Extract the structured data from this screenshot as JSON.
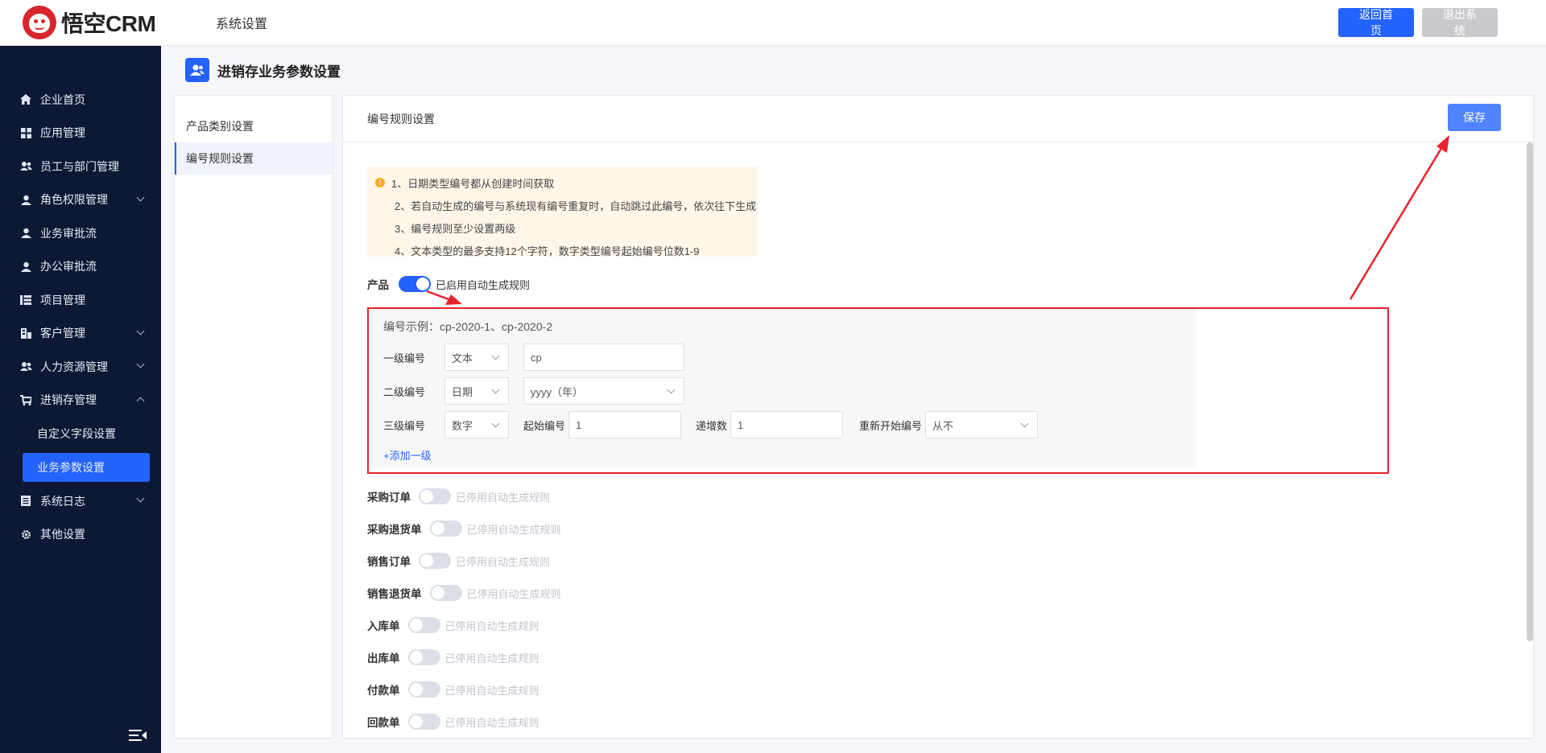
{
  "header": {
    "logo_text": "悟空CRM",
    "section_title": "系统设置",
    "home_button": "返回首页",
    "logout_button": "退出系统"
  },
  "sidebar": {
    "items": [
      {
        "label": "企业首页",
        "icon": "home-icon"
      },
      {
        "label": "应用管理",
        "icon": "apps-grid-icon"
      },
      {
        "label": "员工与部门管理",
        "icon": "users-icon"
      },
      {
        "label": "角色权限管理",
        "icon": "user-icon",
        "expandable": true
      },
      {
        "label": "业务审批流",
        "icon": "user-icon"
      },
      {
        "label": "办公审批流",
        "icon": "user-icon"
      },
      {
        "label": "项目管理",
        "icon": "list-icon"
      },
      {
        "label": "客户管理",
        "icon": "building-icon",
        "expandable": true
      },
      {
        "label": "人力资源管理",
        "icon": "users-icon",
        "expandable": true
      },
      {
        "label": "进销存管理",
        "icon": "cart-icon",
        "expandable": true,
        "expanded": true
      }
    ],
    "sub_items": [
      "自定义字段设置",
      "业务参数设置"
    ],
    "active_sub": "业务参数设置",
    "after_items": [
      {
        "label": "系统日志",
        "icon": "document-icon",
        "expandable": true
      },
      {
        "label": "其他设置",
        "icon": "gear-icon"
      }
    ]
  },
  "page": {
    "title": "进销存业务参数设置"
  },
  "left_menu": {
    "items": [
      "产品类别设置",
      "编号规则设置"
    ],
    "active": "编号规则设置"
  },
  "main": {
    "heading": "编号规则设置",
    "save_button": "保存",
    "tips": [
      "1、日期类型编号都从创建时间获取",
      "2、若自动生成的编号与系统现有编号重复时，自动跳过此编号，依次往下生成",
      "3、编号规则至少设置两级",
      "4、文本类型的最多支持12个字符，数字类型编号起始编号位数1-9"
    ],
    "product": {
      "label": "产品",
      "toggle_state": "已启用自动生成规则",
      "enabled": true,
      "example": "编号示例：cp-2020-1、cp-2020-2",
      "levels": [
        {
          "label": "一级编号",
          "type": "文本",
          "value": "cp"
        },
        {
          "label": "二级编号",
          "type": "日期",
          "value": "yyyy（年）"
        },
        {
          "label": "三级编号",
          "type": "数字",
          "start_label": "起始编号",
          "start_value": "1",
          "step_label": "递增数",
          "step_value": "1",
          "restart_label": "重新开始编号",
          "restart_value": "从不"
        }
      ],
      "add_level": "+添加一级"
    },
    "other_rules": [
      {
        "label": "采购订单",
        "state": "已停用自动生成规则"
      },
      {
        "label": "采购退货单",
        "state": "已停用自动生成规则"
      },
      {
        "label": "销售订单",
        "state": "已停用自动生成规则"
      },
      {
        "label": "销售退货单",
        "state": "已停用自动生成规则"
      },
      {
        "label": "入库单",
        "state": "已停用自动生成规则"
      },
      {
        "label": "出库单",
        "state": "已停用自动生成规则"
      },
      {
        "label": "付款单",
        "state": "已停用自动生成规则"
      },
      {
        "label": "回款单",
        "state": "已停用自动生成规则"
      }
    ]
  },
  "colors": {
    "primary": "#2362fb",
    "sidebar_bg": "#0c1834",
    "annotation_red": "#e8232b",
    "tips_bg": "#fff6e9"
  }
}
